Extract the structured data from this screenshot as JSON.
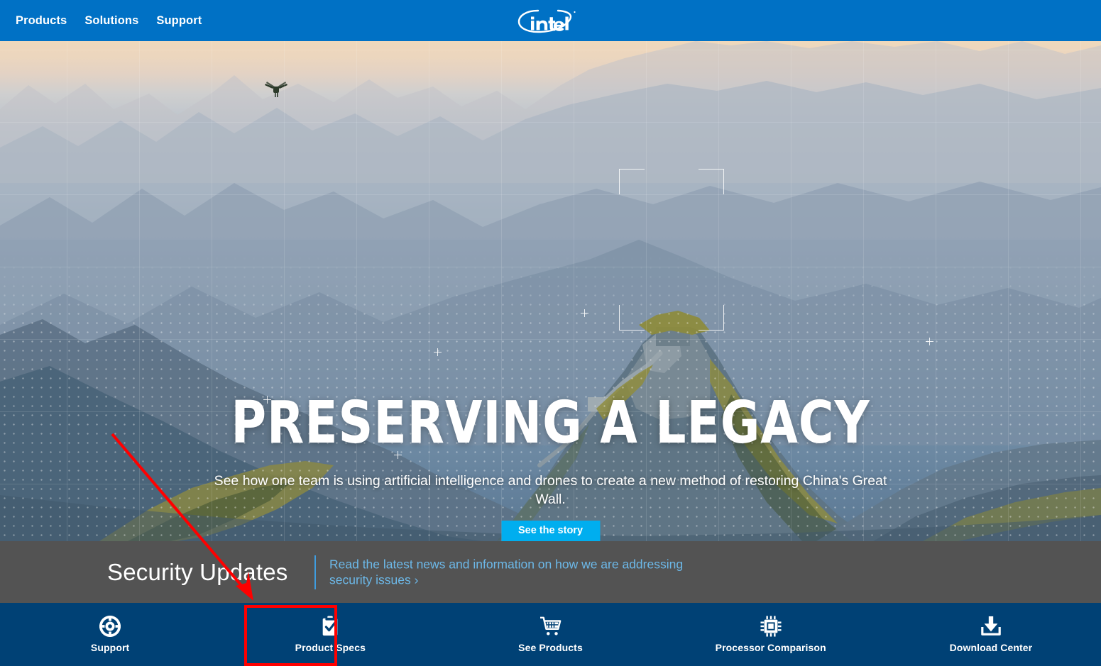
{
  "header": {
    "nav_items": [
      {
        "label": "Products",
        "name": "products"
      },
      {
        "label": "Solutions",
        "name": "solutions"
      },
      {
        "label": "Support",
        "name": "support"
      }
    ],
    "logo_text": "intel",
    "logo_alt": "intel-logo",
    "background_color": "#0071c5"
  },
  "hero": {
    "title": "PRESERVING A LEGACY",
    "subtitle": "See how one team is using artificial intelligence and drones to create a new method of restoring China's Great Wall.",
    "cta_label": "See the story",
    "cta_color": "#00aeef",
    "scene_alt": "great-wall-mountain-ridge-photo",
    "drone_alt": "drone-silhouette"
  },
  "security_bar": {
    "title": "Security Updates",
    "link_text": "Read the latest news and information on how we are addressing security issues ›",
    "background_color": "#535353",
    "link_color": "#6cb8e8",
    "divider_color": "#3f9de0"
  },
  "bottom_nav": {
    "background_color": "#004175",
    "items": [
      {
        "label": "Support",
        "icon": "life-ring-icon",
        "name": "support"
      },
      {
        "label": "Product Specs",
        "icon": "clipboard-check-icon",
        "name": "product-specs"
      },
      {
        "label": "See Products",
        "icon": "shopping-cart-icon",
        "name": "see-products"
      },
      {
        "label": "Processor Comparison",
        "icon": "cpu-chip-icon",
        "name": "processor-comparison"
      },
      {
        "label": "Download Center",
        "icon": "download-tray-icon",
        "name": "download-center"
      }
    ]
  },
  "annotations": {
    "arrow_color": "#ff0000",
    "highlight_color": "#ff0000",
    "arrow_target": "Support",
    "highlight_target": "Support"
  }
}
